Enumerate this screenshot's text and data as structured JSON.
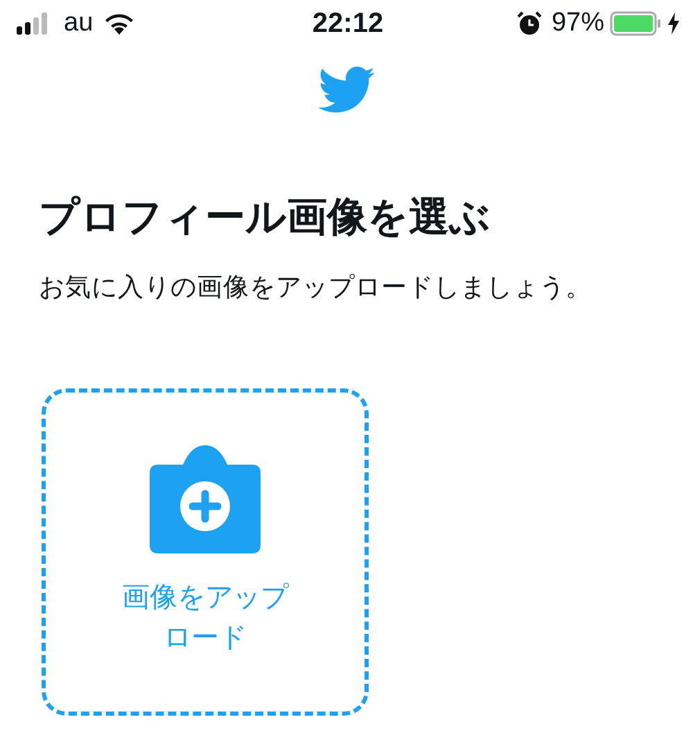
{
  "status_bar": {
    "carrier": "au",
    "time": "22:12",
    "battery_percent": "97%"
  },
  "title": "プロフィール画像を選ぶ",
  "subtitle": "お気に入りの画像をアップロードしましょう。",
  "upload": {
    "label": "画像をアップロード"
  }
}
